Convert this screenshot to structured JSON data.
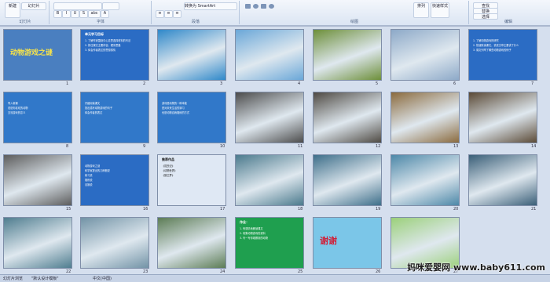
{
  "ribbon": {
    "groups": [
      {
        "label": "幻灯片",
        "buttons": [
          "新建",
          "幻灯片"
        ]
      },
      {
        "label": "字体",
        "buttons": [
          "B",
          "I",
          "U",
          "S",
          "abc",
          "A"
        ]
      },
      {
        "label": "段落",
        "buttons": [
          "≡",
          "≡",
          "≡"
        ]
      },
      {
        "label": "绘图",
        "buttons": [
          "形状",
          "排列",
          "快速样式"
        ]
      },
      {
        "label": "编辑",
        "buttons": [
          "查找",
          "替换",
          "选择"
        ]
      }
    ],
    "smartart_label": "转换为 SmartArt"
  },
  "slides": [
    {
      "n": "1",
      "bg": "#4a7fc0",
      "kind": "title",
      "title": "动物游戏之谜"
    },
    {
      "n": "2",
      "bg": "#2b6cc4",
      "kind": "text",
      "heading": "单元学习目标",
      "lines": [
        "1. 了解作家围绕中心意思选择材料的写法",
        "2. 抓住课文主要内容，理清思路",
        "3. 体会作者表达的思想感情"
      ]
    },
    {
      "n": "3",
      "bg": "#2f88c9",
      "kind": "photo"
    },
    {
      "n": "4",
      "bg": "#6aa7d8",
      "kind": "photo"
    },
    {
      "n": "5",
      "bg": "#6d8f3a",
      "kind": "photo"
    },
    {
      "n": "6",
      "bg": "#8da9c8",
      "kind": "photo"
    },
    {
      "n": "7",
      "bg": "#2b6cc4",
      "kind": "text",
      "heading": "",
      "lines": [
        "1. 了解动物游戏的研究",
        "2. 快速默读课文，说说文章主要讲了什么",
        "3. 课文列举了哪些动物游戏的例子"
      ]
    },
    {
      "n": "8",
      "bg": "#3178c9",
      "kind": "text",
      "heading": "",
      "lines": [
        "导入新课",
        "说说你喜欢的动物",
        "交流游戏的意义"
      ]
    },
    {
      "n": "9",
      "bg": "#3178c9",
      "kind": "text",
      "heading": "",
      "lines": [
        "仔细阅读课文",
        "找出描写动物游戏的句子",
        "体会作者的表达"
      ]
    },
    {
      "n": "10",
      "bg": "#3178c9",
      "kind": "text",
      "heading": "",
      "lines": [
        "游戏是动物的一种本能",
        "是对未来生活的演习",
        "也是动物自我锻炼的方式"
      ]
    },
    {
      "n": "11",
      "bg": "#4c4c4c",
      "kind": "photo"
    },
    {
      "n": "12",
      "bg": "#4f4a43",
      "kind": "photo"
    },
    {
      "n": "13",
      "bg": "#8b6b3e",
      "kind": "photo"
    },
    {
      "n": "14",
      "bg": "#5b4a36",
      "kind": "photo"
    },
    {
      "n": "15",
      "bg": "#5d5d5d",
      "kind": "photo"
    },
    {
      "n": "16",
      "bg": "#2b6cc4",
      "kind": "text",
      "heading": "",
      "lines": [
        "动物游戏之谜",
        "科学家提出的几种假说",
        "练习说",
        "锻炼说",
        "自娱说"
      ]
    },
    {
      "n": "17",
      "bg": "#dfe8f4",
      "kind": "text",
      "heading": "推荐作品",
      "lines": [
        "《昆虫记》",
        "《动物世界》",
        "《狼王梦》"
      ]
    },
    {
      "n": "18",
      "bg": "#4b7a8d",
      "kind": "photo"
    },
    {
      "n": "19",
      "bg": "#3e6f8a",
      "kind": "photo"
    },
    {
      "n": "20",
      "bg": "#4d88a8",
      "kind": "photo"
    },
    {
      "n": "21",
      "bg": "#3a5f78",
      "kind": "photo"
    },
    {
      "n": "22",
      "bg": "#4f7d8f",
      "kind": "photo"
    },
    {
      "n": "23",
      "bg": "#7293a6",
      "kind": "photo"
    },
    {
      "n": "24",
      "bg": "#5c7c55",
      "kind": "photo"
    },
    {
      "n": "25",
      "bg": "#1f9f4f",
      "kind": "text",
      "heading": "作业：",
      "lines": [
        "1. 有感情地朗读课文",
        "2. 收集动物游戏的资料",
        "3. 写一写你观察到的动物"
      ]
    },
    {
      "n": "26",
      "bg": "#7bc6e8",
      "kind": "thanks",
      "title": "谢谢"
    },
    {
      "n": "27",
      "bg": "#9bd07a",
      "kind": "photo"
    }
  ],
  "status": {
    "slide_info": "幻灯片浏览",
    "theme": "\"默认设计模板\"",
    "language": "中文(中国)"
  },
  "watermark": "妈咪爱婴网 www.baby611.com",
  "colors": {
    "ribbon_bg": "#dbe5f3",
    "app_bg": "#d5dfee"
  }
}
